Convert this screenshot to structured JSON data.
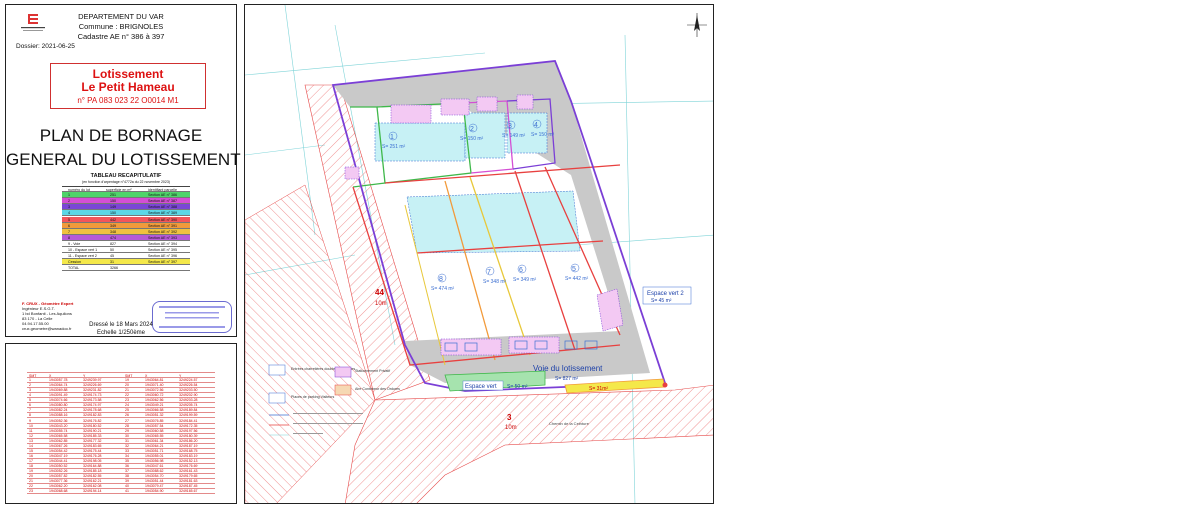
{
  "header": {
    "department": "DEPARTEMENT DU VAR",
    "commune": "Commune : BRIGNOLES",
    "cadastre": "Cadastre      AE n° 386 à 397",
    "dossier": "Dossier:  2021-06-25"
  },
  "lotissement": {
    "title": "Lotissement",
    "name": "Le Petit Hameau",
    "reference": "n° PA 083 023 22 O0014 M1"
  },
  "plan_title": {
    "line1": "PLAN DE BORNAGE",
    "line2": "GENERAL DU LOTISSEMENT"
  },
  "recap": {
    "title": "TABLEAU RECAPITULATIF",
    "subtitle": "(en fonction d'arpentage n°4772a du 22 novembre 2023)",
    "headers": [
      "numéro du lot",
      "superficie en m²",
      "identifiant parcelle"
    ],
    "rows": [
      {
        "lot": "1",
        "area": "251",
        "parcel": "Section AE n° 386",
        "color": "#4fd46a"
      },
      {
        "lot": "2",
        "area": "150",
        "parcel": "Section AE n° 387",
        "color": "#d44fd4"
      },
      {
        "lot": "3",
        "area": "149",
        "parcel": "Section AE n° 388",
        "color": "#7a46d6"
      },
      {
        "lot": "4",
        "area": "150",
        "parcel": "Section AE n° 389",
        "color": "#5cd7e6"
      },
      {
        "lot": "5",
        "area": "442",
        "parcel": "Section AE n° 390",
        "color": "#f2555b"
      },
      {
        "lot": "6",
        "area": "349",
        "parcel": "Section AE n° 391",
        "color": "#f19a3b"
      },
      {
        "lot": "7",
        "area": "348",
        "parcel": "Section AE n° 392",
        "color": "#f0c13f"
      },
      {
        "lot": "8",
        "area": "474",
        "parcel": "Section AE n° 393",
        "color": "#b55ad6"
      },
      {
        "lot": "9 - Voie",
        "area": "827",
        "parcel": "Section AE n° 394",
        "color": "#ffffff"
      },
      {
        "lot": "10 - Espace vert 1",
        "area": "50",
        "parcel": "Section AE n° 395",
        "color": "#ffffff"
      },
      {
        "lot": "11 - Espace vert 2",
        "area": "45",
        "parcel": "Section AE n° 396",
        "color": "#ffffff"
      },
      {
        "lot": "Cession",
        "area": "31",
        "parcel": "Section AE n° 397",
        "color": "#f4e84a"
      },
      {
        "lot": "TOTAL",
        "area": "3266",
        "parcel": "",
        "color": "#ffffff"
      }
    ]
  },
  "footer": {
    "date": "Dressé le 18 Mars 2024",
    "scale": "Echelle 1/250ème",
    "surveyor": [
      "F. CRUX - Géomètre Expert",
      "Ingénieur E.S.G.T.",
      "1 bd Bonfanti - Les Aquilons",
      "83 170 - La Celle",
      "04.94.17.55.00",
      "crux.geometre@wanadoo.fr"
    ]
  },
  "coords": {
    "title": "Coordonnées des sommets",
    "headers": [
      "SMT",
      "X",
      "Y",
      "SMT",
      "X",
      "Y"
    ],
    "rows": [
      [
        "1",
        "1943057.78",
        "3249239.97",
        "19",
        "1943064.81",
        "3249224.57"
      ],
      [
        "2",
        "1943064.74",
        "3249226.69",
        "20",
        "1943071.40",
        "3249226.54"
      ],
      [
        "3",
        "1943069.88",
        "3249231.82",
        "21",
        "1943072.56",
        "3249203.50"
      ],
      [
        "4",
        "1943091.49",
        "3249174.73",
        "22",
        "1943060.72",
        "3249202.90"
      ],
      [
        "5",
        "1943074.66",
        "3249173.58",
        "23",
        "1943062.56",
        "3249203.28"
      ],
      [
        "6",
        "1943080.80",
        "3249174.97",
        "24",
        "1943049.21",
        "3249205.74"
      ],
      [
        "7",
        "1943082.24",
        "3249178.68",
        "25",
        "1943066.58",
        "3249189.84"
      ],
      [
        "8",
        "1943088.16",
        "3249182.83",
        "26",
        "1943051.32",
        "3249199.59"
      ],
      [
        "9",
        "1943052.36",
        "3249176.82",
        "27",
        "1943076.85",
        "3249184.41"
      ],
      [
        "10",
        "1943043.20",
        "3249180.52",
        "28",
        "1943057.54",
        "3249172.35"
      ],
      [
        "11",
        "1943055.74",
        "3249190.21",
        "29",
        "1943060.58",
        "3249197.56"
      ],
      [
        "12",
        "1943065.58",
        "3249185.33",
        "30",
        "1943065.55",
        "3249180.39"
      ],
      [
        "13",
        "1943062.85",
        "3249177.32",
        "31",
        "1943061.34",
        "3249186.20"
      ],
      [
        "14",
        "1943067.26",
        "3249183.65",
        "32",
        "1943064.21",
        "3249187.19"
      ],
      [
        "15",
        "1943054.42",
        "3249175.44",
        "33",
        "1943051.71",
        "3249168.75"
      ],
      [
        "16",
        "1943047.19",
        "3249176.28",
        "34",
        "1943055.01",
        "3249183.19"
      ],
      [
        "17",
        "1943044.41",
        "3249198.05",
        "35",
        "1943056.98",
        "3249152.13"
      ],
      [
        "18",
        "1943050.52",
        "3249164.88",
        "36",
        "1943047.61",
        "3249176.69"
      ],
      [
        "19",
        "1943052.26",
        "3249185.18",
        "37",
        "1943088.62",
        "3249161.43"
      ],
      [
        "20",
        "1943057.82",
        "3249182.55",
        "38",
        "1943054.70",
        "3249179.65"
      ],
      [
        "21",
        "1943077.36",
        "3249162.21",
        "39",
        "1943051.44",
        "3249181.63"
      ],
      [
        "22",
        "1943062.20",
        "3249162.08",
        "40",
        "1943079.47",
        "3249187.45"
      ],
      [
        "23",
        "1943068.68",
        "3249194.14",
        "41",
        "1943054.90",
        "3249165.67"
      ]
    ]
  },
  "lots": [
    {
      "num": "1",
      "area": "S= 251 m²"
    },
    {
      "num": "2",
      "area": "S= 150 m²"
    },
    {
      "num": "3",
      "area": "S= 149 m²"
    },
    {
      "num": "4",
      "area": "S= 150 m²"
    },
    {
      "num": "5",
      "area": "S= 442 m²"
    },
    {
      "num": "6",
      "area": "S= 349 m²"
    },
    {
      "num": "7",
      "area": "S= 348 m²"
    },
    {
      "num": "8",
      "area": "S= 474 m²"
    }
  ],
  "plan": {
    "voie_label": "Voie du lotissement",
    "voie_area": "S= 827 m²",
    "espace_vert1_label": "Espace vert",
    "espace_vert1_area": "S= 50 m²",
    "espace_vert2_label": "Espace vert 2",
    "espace_vert2_area": "S= 45 m²",
    "cession_area": "S= 31m²",
    "road_44_num": "44",
    "road_44_width": "10m",
    "road_3_num": "3",
    "road_3_width": "10m",
    "chemin_label": "Chemin de la Ceinture",
    "legend": [
      "Entrées charretières doubles non closes",
      "Places de parking Visiteurs",
      "Stationnement Privatif",
      "Aire Conteneur des Ordures"
    ]
  },
  "colors": {
    "boundary_purple": "#7b3fd6",
    "lot_red": "#e8403f",
    "lot_orange": "#f29a3a",
    "lot_yellow": "#e8c83a",
    "lot_green": "#3fb84a",
    "building_cyan": "#c7f1f5",
    "road_gray": "#c9c9c9",
    "hatch_red": "#e64a4a"
  }
}
